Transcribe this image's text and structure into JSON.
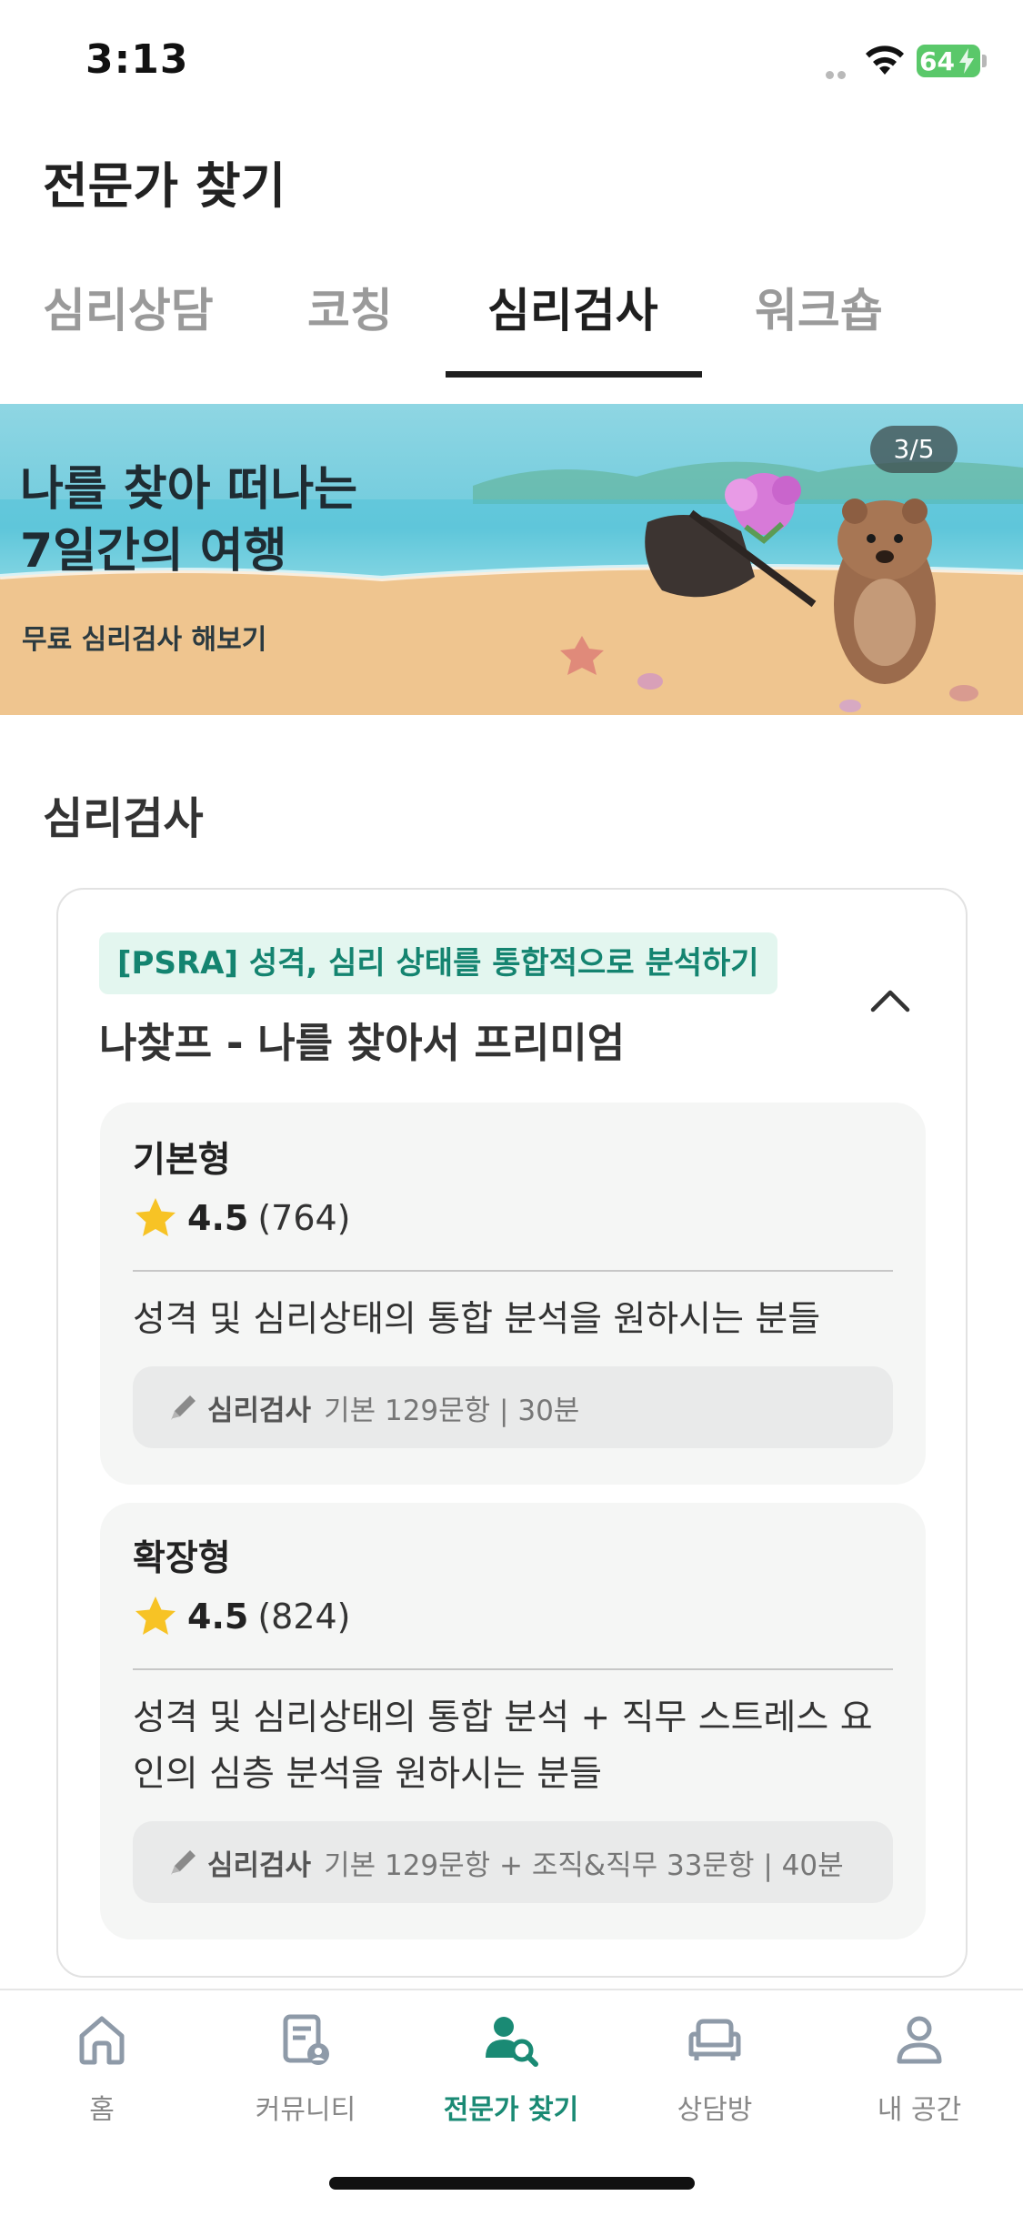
{
  "status_bar": {
    "time": "3:13",
    "battery": "64"
  },
  "header": {
    "title": "전문가 찾기"
  },
  "tabs": [
    {
      "label": "심리상담",
      "active": false
    },
    {
      "label": "코칭",
      "active": false
    },
    {
      "label": "심리검사",
      "active": true
    },
    {
      "label": "워크숍",
      "active": false
    }
  ],
  "banner": {
    "title_line1": "나를 찾아 떠나는",
    "title_line2": "7일간의 여행",
    "subtitle": "무료 심리검사 해보기",
    "counter": "3/5"
  },
  "section": {
    "title": "심리검사"
  },
  "product": {
    "tag": "[PSRA] 성격, 심리 상태를 통합적으로 분석하기",
    "title": "나찾프 - 나를 찾아서 프리미엄",
    "expanded": true,
    "options": [
      {
        "name": "기본형",
        "rating": "4.5",
        "reviews": "(764)",
        "description": "성격 및 심리상태의 통합 분석을 원하시는 분들",
        "info_label": "심리검사",
        "info_detail": "기본 129문항 | 30분"
      },
      {
        "name": "확장형",
        "rating": "4.5",
        "reviews": "(824)",
        "description_line1": "성격 및 심리상태의 통합 분석 + 직무 스트레스 요",
        "description_line2": "인의 심층 분석을 원하시는 분들",
        "info_label": "심리검사",
        "info_detail": "기본 129문항 + 조직&직무 33문항 | 40분"
      }
    ]
  },
  "bottom_nav": [
    {
      "label": "홈",
      "icon": "home-icon",
      "active": false
    },
    {
      "label": "커뮤니티",
      "icon": "community-icon",
      "active": false
    },
    {
      "label": "전문가 찾기",
      "icon": "expert-search-icon",
      "active": true
    },
    {
      "label": "상담방",
      "icon": "sofa-icon",
      "active": false
    },
    {
      "label": "내 공간",
      "icon": "person-icon",
      "active": false
    }
  ],
  "colors": {
    "accent": "#1a8a74",
    "tag_bg": "#e3f6ef",
    "tag_text": "#148470",
    "star": "#f7c325"
  }
}
